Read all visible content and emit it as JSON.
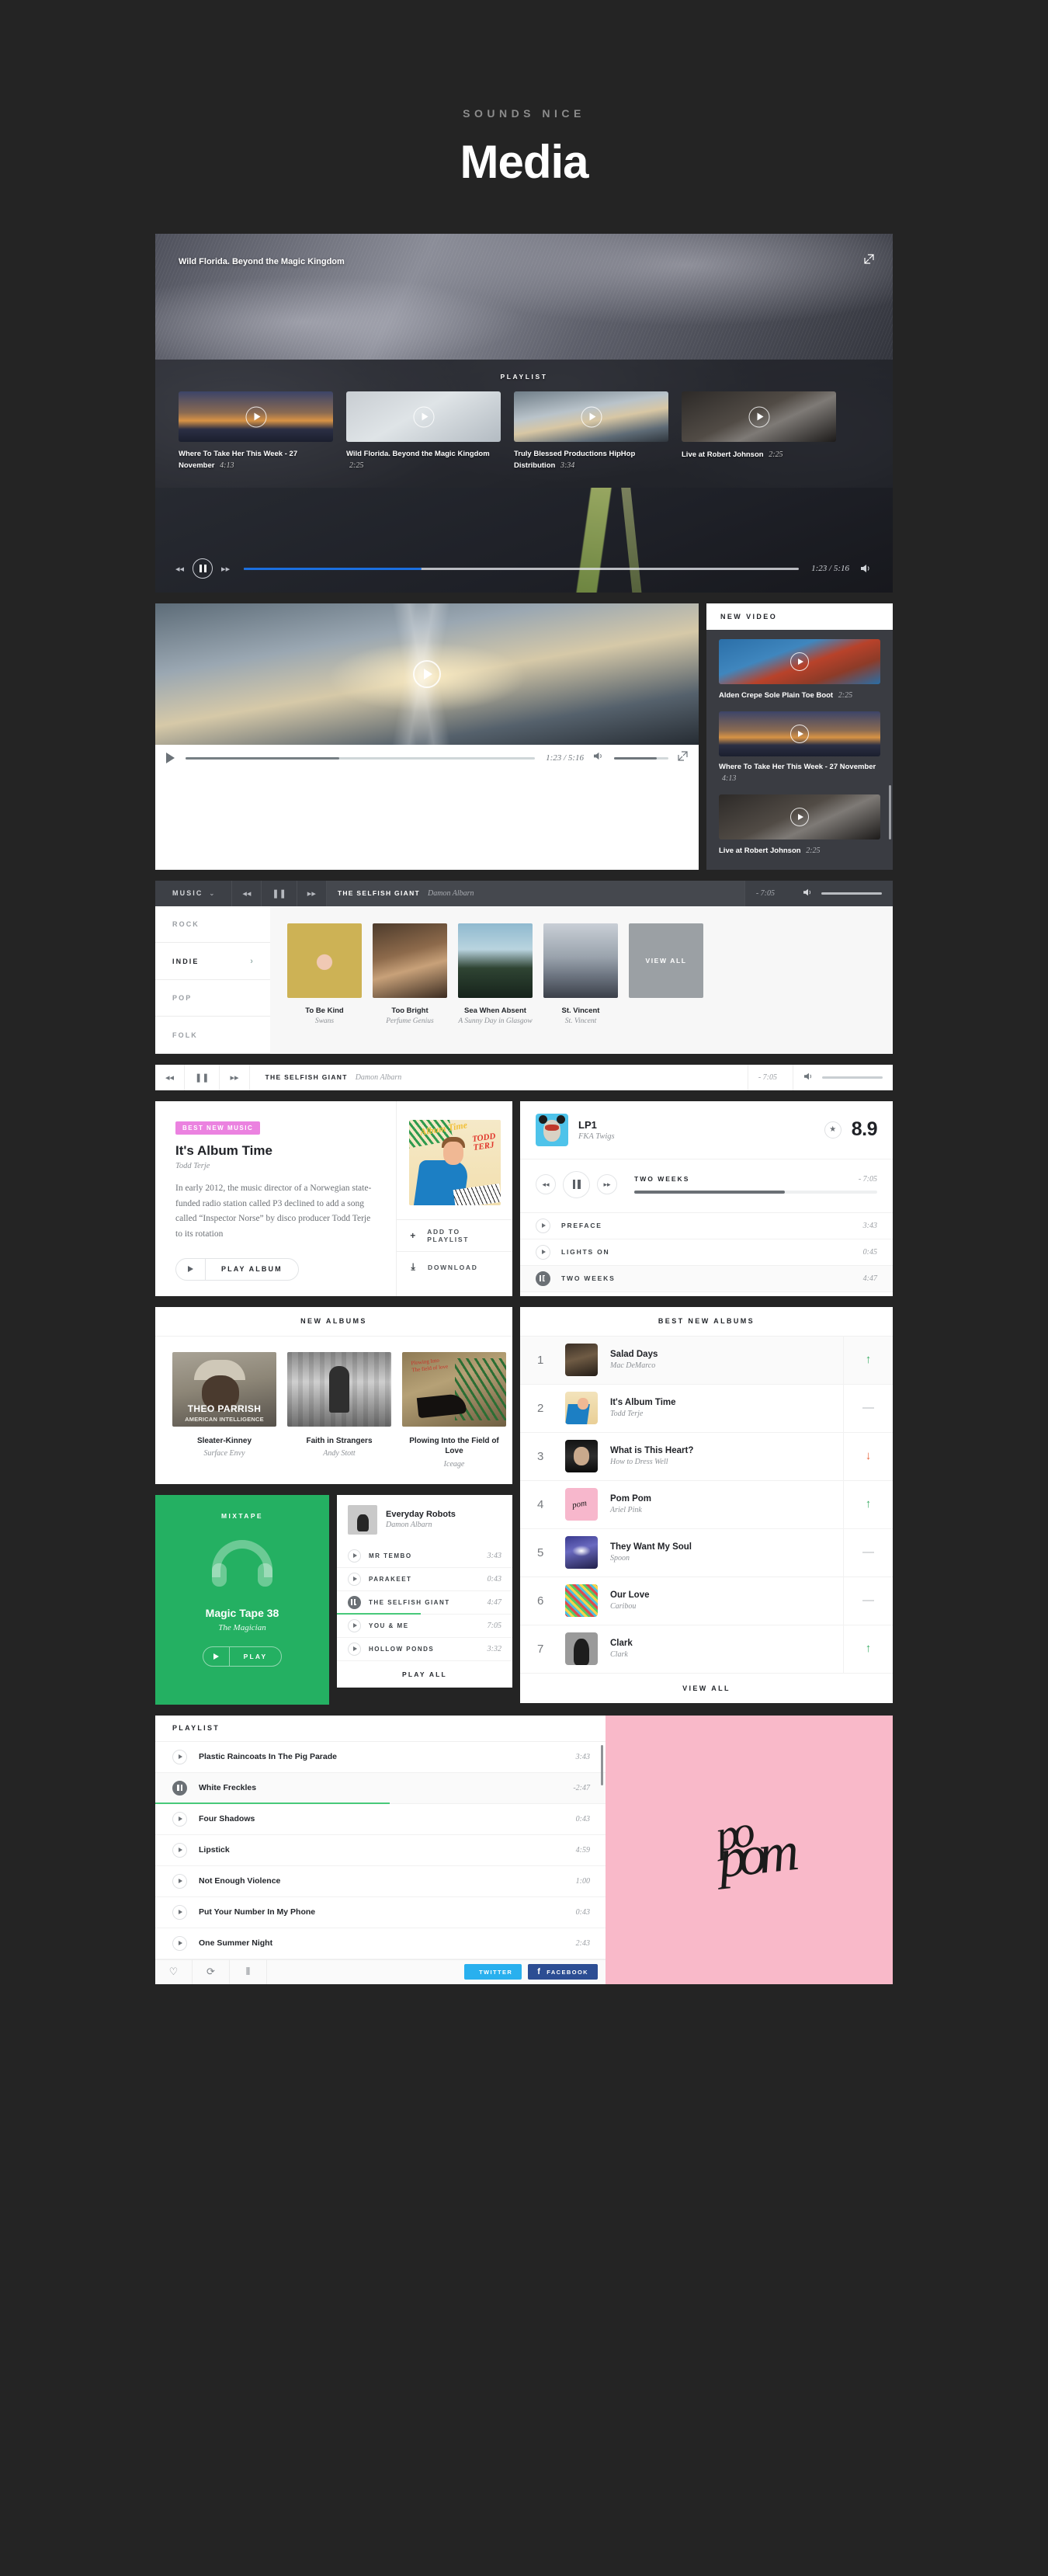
{
  "header": {
    "kicker": "SOUNDS NICE",
    "title": "Media"
  },
  "hero": {
    "title": "Wild Florida. Beyond the Magic Kingdom",
    "expand_icon": "expand-icon",
    "playlist_label": "PLAYLIST",
    "items": [
      {
        "title": "Where To Take Her This Week - 27 November",
        "duration": "4:13"
      },
      {
        "title": "Wild Florida. Beyond the Magic Kingdom",
        "duration": "2:25"
      },
      {
        "title": "Truly Blessed Productions HipHop Distribution",
        "duration": "3:34"
      },
      {
        "title": "Live at Robert Johnson",
        "duration": "2:25"
      }
    ],
    "controls": {
      "prev_icon": "rewind-icon",
      "pause_icon": "pause-icon",
      "next_icon": "fast-forward-icon",
      "time": "1:23 / 5:16",
      "volume_icon": "speaker-icon",
      "progress_percent": 32
    }
  },
  "video_section": {
    "play_icon": "play-icon",
    "bar": {
      "play_icon": "play-icon",
      "time": "1:23 / 5:16",
      "volume_icon": "speaker-icon",
      "fullscreen_icon": "fullscreen-icon",
      "progress_percent": 44,
      "volume_percent": 78
    },
    "new_video": {
      "header": "NEW VIDEO",
      "items": [
        {
          "title": "Alden Crepe Sole Plain Toe Boot",
          "duration": "2:25"
        },
        {
          "title": "Where To Take Her This Week - 27 November",
          "duration": "4:13"
        },
        {
          "title": "Live at Robert Johnson",
          "duration": "2:25"
        }
      ]
    }
  },
  "music_bar": {
    "selector": "MUSIC",
    "chevron": "chevron-down-icon",
    "prev_icon": "rewind-icon",
    "pause_icon": "pause-icon",
    "next_icon": "fast-forward-icon",
    "track": "THE SELFISH GIANT",
    "artist": "Damon Albarn",
    "remaining": "- 7:05",
    "volume_icon": "speaker-icon"
  },
  "genres": [
    {
      "label": "ROCK",
      "active": false
    },
    {
      "label": "INDIE",
      "active": true
    },
    {
      "label": "POP",
      "active": false
    },
    {
      "label": "FOLK",
      "active": false
    }
  ],
  "album_grid": {
    "albums": [
      {
        "name": "To Be Kind",
        "artist": "Swans"
      },
      {
        "name": "Too Bright",
        "artist": "Perfume Genius"
      },
      {
        "name": "Sea When Absent",
        "artist": "A Sunny Day in Glasgow"
      },
      {
        "name": "St. Vincent",
        "artist": "St. Vincent"
      }
    ],
    "view_all": "VIEW ALL"
  },
  "white_bar": {
    "prev_icon": "rewind-icon",
    "pause_icon": "pause-icon",
    "next_icon": "fast-forward-icon",
    "track": "THE SELFISH GIANT",
    "artist": "Damon Albarn",
    "remaining": "- 7:05",
    "volume_icon": "speaker-icon"
  },
  "best_new_music": {
    "badge": "BEST NEW MUSIC",
    "title": "It's Album Time",
    "artist": "Todd Terje",
    "body": "In early 2012, the music director of a Norwegian state-funded radio station called P3 declined to add a song called “Inspector Norse” by disco producer Todd Terje to its rotation",
    "play_label": "PLAY ALBUM",
    "play_icon": "play-icon",
    "actions": [
      {
        "icon": "plus-icon",
        "label": "ADD TO PLAYLIST"
      },
      {
        "icon": "download-icon",
        "label": "DOWNLOAD"
      }
    ]
  },
  "lp_card": {
    "title": "LP1",
    "artist": "FKA Twigs",
    "star_icon": "star-icon",
    "score": "8.9",
    "controls": {
      "prev_icon": "rewind-icon",
      "pause_icon": "pause-icon",
      "next_icon": "fast-forward-icon"
    },
    "now_playing": "TWO WEEKS",
    "remaining": "- 7:05",
    "progress_percent": 62,
    "tracks": [
      {
        "name": "PREFACE",
        "duration": "3:43",
        "playing": false
      },
      {
        "name": "LIGHTS ON",
        "duration": "0:45",
        "playing": false
      },
      {
        "name": "TWO WEEKS",
        "duration": "4:47",
        "playing": true
      }
    ]
  },
  "new_albums": {
    "header": "NEW ALBUMS",
    "items": [
      {
        "name": "Sleater-Kinney",
        "artist": "Surface Envy"
      },
      {
        "name": "Faith in Strangers",
        "artist": "Andy Stott"
      },
      {
        "name": "Plowing Into the Field of Love",
        "artist": "Iceage"
      }
    ]
  },
  "best_new_albums": {
    "header": "BEST NEW ALBUMS",
    "view_all": "VIEW ALL",
    "rows": [
      {
        "rank": "1",
        "title": "Salad Days",
        "artist": "Mac DeMarco",
        "trend": "up"
      },
      {
        "rank": "2",
        "title": "It's Album Time",
        "artist": "Todd Terje",
        "trend": "flat"
      },
      {
        "rank": "3",
        "title": "What is This Heart?",
        "artist": "How to Dress Well",
        "trend": "down"
      },
      {
        "rank": "4",
        "title": "Pom Pom",
        "artist": "Ariel Pink",
        "trend": "up"
      },
      {
        "rank": "5",
        "title": "They Want My Soul",
        "artist": "Spoon",
        "trend": "flat"
      },
      {
        "rank": "6",
        "title": "Our Love",
        "artist": "Caribou",
        "trend": "flat"
      },
      {
        "rank": "7",
        "title": "Clark",
        "artist": "Clark",
        "trend": "up"
      }
    ],
    "trend_colors": {
      "up": "#3fae68",
      "down": "#e8653c",
      "flat": "#b3b7bb"
    }
  },
  "mixtape": {
    "label": "MIXTAPE",
    "icon": "headphones-icon",
    "title": "Magic Tape 38",
    "artist": "The Magician",
    "play_label": "PLAY",
    "play_icon": "play-icon",
    "accent_color": "#24b062"
  },
  "everyday_robots": {
    "title": "Everyday Robots",
    "artist": "Damon Albarn",
    "tracks": [
      {
        "name": "MR TEMBO",
        "duration": "3:43",
        "playing": false
      },
      {
        "name": "PARAKEET",
        "duration": "0:43",
        "playing": false
      },
      {
        "name": "THE SELFISH GIANT",
        "duration": "4:47",
        "playing": true
      },
      {
        "name": "YOU & ME",
        "duration": "7:05",
        "playing": false
      },
      {
        "name": "HOLLOW PONDS",
        "duration": "3:32",
        "playing": false
      }
    ],
    "play_all": "PLAY ALL"
  },
  "playlist_card": {
    "header": "PLAYLIST",
    "rows": [
      {
        "name": "Plastic Raincoats In The Pig Parade",
        "duration": "3:43",
        "playing": false
      },
      {
        "name": "White Freckles",
        "duration": "-2:47",
        "playing": true
      },
      {
        "name": "Four Shadows",
        "duration": "0:43",
        "playing": false
      },
      {
        "name": "Lipstick",
        "duration": "4:59",
        "playing": false
      },
      {
        "name": "Not Enough Violence",
        "duration": "1:00",
        "playing": false
      },
      {
        "name": "Put Your Number In My Phone",
        "duration": "0:43",
        "playing": false
      },
      {
        "name": "One Summer Night",
        "duration": "2:43",
        "playing": false
      }
    ],
    "footer": {
      "heart_icon": "heart-icon",
      "repeat_icon": "repeat-icon",
      "equalizer_icon": "equalizer-icon",
      "twitter_label": "TWITTER",
      "facebook_label": "FACEBOOK",
      "twitter_color": "#29b0ee",
      "facebook_color": "#2c4d93"
    },
    "artwork_color": "#f9b9c9",
    "artwork_text": "pom"
  }
}
